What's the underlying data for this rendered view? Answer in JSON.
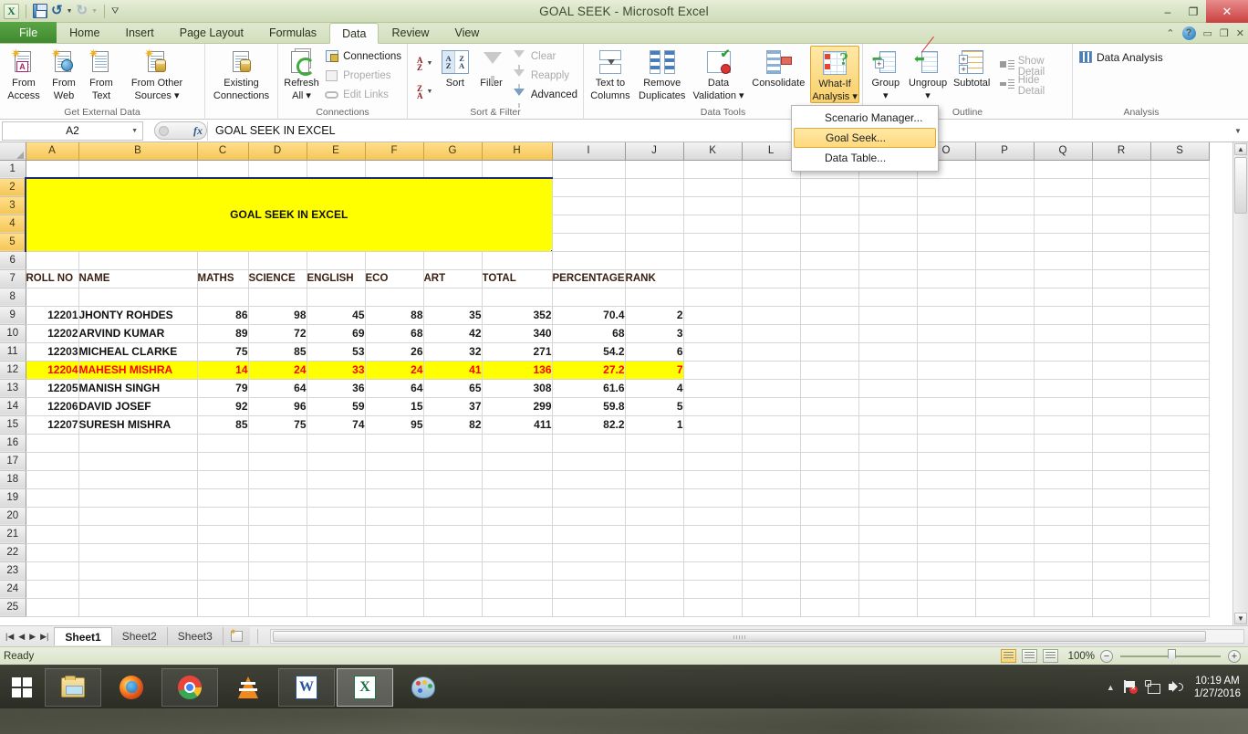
{
  "window": {
    "title": "GOAL SEEK  -  Microsoft Excel",
    "minimize": "–",
    "restore": "❐",
    "close": "✕"
  },
  "quick_access": {
    "logo": "excel-logo",
    "save": "Save",
    "undo": "Undo",
    "redo": "Redo",
    "customize": "Customize Quick Access Toolbar"
  },
  "tabs": [
    {
      "label": "File",
      "active": false
    },
    {
      "label": "Home",
      "active": false
    },
    {
      "label": "Insert",
      "active": false
    },
    {
      "label": "Page Layout",
      "active": false
    },
    {
      "label": "Formulas",
      "active": false
    },
    {
      "label": "Data",
      "active": true
    },
    {
      "label": "Review",
      "active": false
    },
    {
      "label": "View",
      "active": false
    }
  ],
  "ribbon": {
    "groups": [
      {
        "name": "Get External Data",
        "buttons": [
          {
            "label_line1": "From",
            "label_line2": "Access"
          },
          {
            "label_line1": "From",
            "label_line2": "Web"
          },
          {
            "label_line1": "From",
            "label_line2": "Text"
          },
          {
            "label_line1": "From Other",
            "label_line2": "Sources ▾"
          }
        ]
      },
      {
        "name": "",
        "buttons": [
          {
            "label_line1": "Existing",
            "label_line2": "Connections"
          }
        ]
      },
      {
        "name": "Connections",
        "buttons": [
          {
            "label_line1": "Refresh",
            "label_line2": "All ▾"
          }
        ],
        "small_buttons": [
          {
            "label": "Connections",
            "disabled": false
          },
          {
            "label": "Properties",
            "disabled": true
          },
          {
            "label": "Edit Links",
            "disabled": true
          }
        ]
      },
      {
        "name": "Sort & Filter",
        "buttons": [
          {
            "label_line1": "Sort",
            "label_line2": ""
          },
          {
            "label_line1": "Filter",
            "label_line2": ""
          }
        ],
        "small_buttons": [
          {
            "label": "Clear",
            "disabled": true
          },
          {
            "label": "Reapply",
            "disabled": true
          },
          {
            "label": "Advanced",
            "disabled": false
          }
        ],
        "sort_asc": "Sort A to Z",
        "sort_desc": "Sort Z to A"
      },
      {
        "name": "Data Tools",
        "buttons": [
          {
            "label_line1": "Text to",
            "label_line2": "Columns"
          },
          {
            "label_line1": "Remove",
            "label_line2": "Duplicates"
          },
          {
            "label_line1": "Data",
            "label_line2": "Validation ▾"
          },
          {
            "label_line1": "Consolidate",
            "label_line2": ""
          },
          {
            "label_line1": "What-If",
            "label_line2": "Analysis ▾"
          }
        ]
      },
      {
        "name": "Outline",
        "buttons": [
          {
            "label_line1": "Group",
            "label_line2": "▾"
          },
          {
            "label_line1": "Ungroup",
            "label_line2": "▾"
          },
          {
            "label_line1": "Subtotal",
            "label_line2": ""
          }
        ],
        "small_buttons": [
          {
            "label": "Show Detail",
            "disabled": true
          },
          {
            "label": "Hide Detail",
            "disabled": true
          }
        ]
      },
      {
        "name": "Analysis",
        "small_buttons": [
          {
            "label": "Data Analysis",
            "disabled": false
          }
        ]
      }
    ]
  },
  "dropdown": {
    "open": true,
    "items": [
      {
        "label": "Scenario Manager...",
        "selected": false
      },
      {
        "label": "Goal Seek...",
        "selected": true
      },
      {
        "label": "Data Table...",
        "selected": false
      }
    ]
  },
  "formula_bar": {
    "name_box": "A2",
    "fx_label": "fx",
    "content": "GOAL SEEK IN EXCEL"
  },
  "sheet": {
    "column_headers": [
      "A",
      "B",
      "C",
      "D",
      "E",
      "F",
      "G",
      "H",
      "I",
      "J",
      "K",
      "L",
      "M",
      "N",
      "O",
      "P",
      "Q",
      "R",
      "S"
    ],
    "row_numbers": [
      1,
      2,
      3,
      4,
      5,
      6,
      7,
      8,
      9,
      10,
      11,
      12,
      13,
      14,
      15,
      16,
      17,
      18,
      19,
      20,
      21,
      22,
      23,
      24,
      25
    ],
    "banner": {
      "text": "GOAL SEEK IN EXCEL",
      "range": "A2:H5",
      "fill": "#ffff00",
      "font_color": "#ff0000",
      "selected": true
    },
    "table_headers": [
      "ROLL NO",
      "NAME",
      "MATHS",
      "SCIENCE",
      "ENGLISH",
      "ECO",
      "ART",
      "TOTAL",
      "PERCENTAGE",
      "RANK"
    ],
    "rows": [
      {
        "row": 9,
        "roll_no": "12201",
        "name": "JHONTY ROHDES",
        "maths": "86",
        "science": "98",
        "english": "45",
        "eco": "88",
        "art": "35",
        "total": "352",
        "percentage": "70.4",
        "rank": "2",
        "highlight": false
      },
      {
        "row": 10,
        "roll_no": "12202",
        "name": "ARVIND KUMAR",
        "maths": "89",
        "science": "72",
        "english": "69",
        "eco": "68",
        "art": "42",
        "total": "340",
        "percentage": "68",
        "rank": "3",
        "highlight": false
      },
      {
        "row": 11,
        "roll_no": "12203",
        "name": "MICHEAL CLARKE",
        "maths": "75",
        "science": "85",
        "english": "53",
        "eco": "26",
        "art": "32",
        "total": "271",
        "percentage": "54.2",
        "rank": "6",
        "highlight": false
      },
      {
        "row": 12,
        "roll_no": "12204",
        "name": "MAHESH MISHRA",
        "maths": "14",
        "science": "24",
        "english": "33",
        "eco": "24",
        "art": "41",
        "total": "136",
        "percentage": "27.2",
        "rank": "7",
        "highlight": true
      },
      {
        "row": 13,
        "roll_no": "12205",
        "name": "MANISH SINGH",
        "maths": "79",
        "science": "64",
        "english": "36",
        "eco": "64",
        "art": "65",
        "total": "308",
        "percentage": "61.6",
        "rank": "4",
        "highlight": false
      },
      {
        "row": 14,
        "roll_no": "12206",
        "name": "DAVID JOSEF",
        "maths": "92",
        "science": "96",
        "english": "59",
        "eco": "15",
        "art": "37",
        "total": "299",
        "percentage": "59.8",
        "rank": "5",
        "highlight": false
      },
      {
        "row": 15,
        "roll_no": "12207",
        "name": "SURESH MISHRA",
        "maths": "85",
        "science": "75",
        "english": "74",
        "eco": "95",
        "art": "82",
        "total": "411",
        "percentage": "82.2",
        "rank": "1",
        "highlight": false
      }
    ],
    "header_row": 7
  },
  "sheet_tabs": {
    "nav": [
      "|◀",
      "◀",
      "▶",
      "▶|"
    ],
    "tabs": [
      {
        "label": "Sheet1",
        "active": true
      },
      {
        "label": "Sheet2",
        "active": false
      },
      {
        "label": "Sheet3",
        "active": false
      }
    ],
    "new_sheet": "insert-worksheet"
  },
  "status_bar": {
    "status": "Ready",
    "zoom": "100%",
    "zoom_out": "−",
    "zoom_in": "+",
    "views": [
      "Normal",
      "Page Layout",
      "Page Break Preview"
    ]
  },
  "taskbar": {
    "start": "Start",
    "apps": [
      {
        "name": "file-explorer"
      },
      {
        "name": "firefox"
      },
      {
        "name": "chrome"
      },
      {
        "name": "vlc"
      },
      {
        "name": "word"
      },
      {
        "name": "excel",
        "active": true
      },
      {
        "name": "paint"
      }
    ],
    "tray": {
      "time": "10:19 AM",
      "date": "1/27/2016"
    }
  }
}
